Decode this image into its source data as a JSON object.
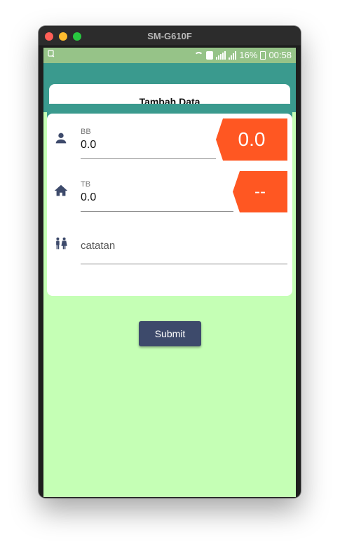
{
  "window": {
    "title": "SM-G610F"
  },
  "statusbar": {
    "battery_percent": "16%",
    "time": "00:58"
  },
  "header": {
    "title": "Tambah Data"
  },
  "form": {
    "bb": {
      "label": "BB",
      "value": "0.0",
      "icon": "person-icon",
      "result": "0.0"
    },
    "tb": {
      "label": "TB",
      "value": "0.0",
      "icon": "home-icon",
      "result": "--"
    },
    "catatan": {
      "placeholder": "catatan",
      "icon": "people-icon"
    }
  },
  "submit": {
    "label": "Submit"
  },
  "colors": {
    "screen_bg": "#c5ffb5",
    "appbar": "#3a9a8e",
    "badge": "#ff5722",
    "button": "#3d4a6b"
  }
}
